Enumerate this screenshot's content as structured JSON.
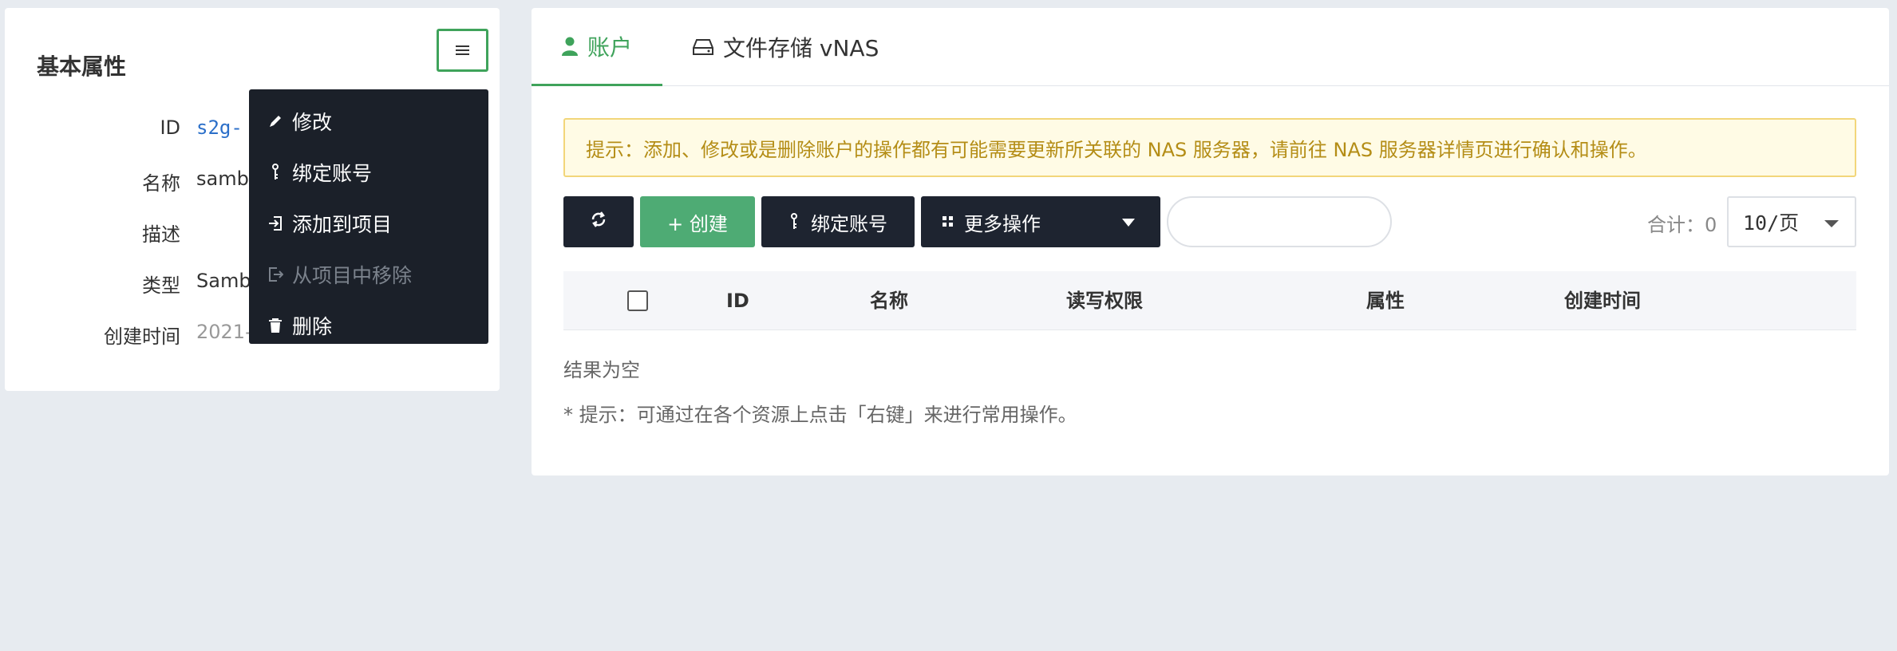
{
  "left_panel": {
    "title": "基本属性",
    "properties": [
      {
        "label": "ID",
        "value": "s2g-"
      },
      {
        "label": "名称",
        "value": "samb"
      },
      {
        "label": "描述",
        "value": ""
      },
      {
        "label": "类型",
        "value": "Samb"
      },
      {
        "label": "创建时间",
        "value": "2021-"
      }
    ],
    "menu_button_icon": "hamburger-menu-icon",
    "dropdown": [
      {
        "label": "修改",
        "icon": "pencil-icon",
        "disabled": false
      },
      {
        "label": "绑定账号",
        "icon": "key-icon",
        "disabled": false
      },
      {
        "label": "添加到项目",
        "icon": "sign-in-icon",
        "disabled": false
      },
      {
        "label": "从项目中移除",
        "icon": "sign-out-icon",
        "disabled": true
      },
      {
        "label": "删除",
        "icon": "trash-icon",
        "disabled": false
      }
    ]
  },
  "right_panel": {
    "tabs": [
      {
        "label": "账户",
        "icon": "user-icon",
        "active": true
      },
      {
        "label": "文件存储 vNAS",
        "icon": "hard-drive-icon",
        "active": false
      }
    ],
    "notice": "提示：添加、修改或是删除账户的操作都有可能需要更新所关联的 NAS 服务器，请前往 NAS 服务器详情页进行确认和操作。",
    "toolbar": {
      "refresh_icon": "refresh-icon",
      "create_label": "+ 创建",
      "bind_label": "绑定账号",
      "more_label": "更多操作",
      "search_placeholder": "",
      "total": "合计：0",
      "page_size": "10/页"
    },
    "table": {
      "columns": [
        "ID",
        "名称",
        "读写权限",
        "属性",
        "创建时间"
      ],
      "rows": []
    },
    "empty_text": "结果为空",
    "hint": "* 提示：可通过在各个资源上点击「右键」来进行常用操作。"
  },
  "colors": {
    "accent": "#3fa35b",
    "dark_button": "#1e2430",
    "notice_bg": "#fffbe5",
    "notice_text": "#b48d16"
  }
}
